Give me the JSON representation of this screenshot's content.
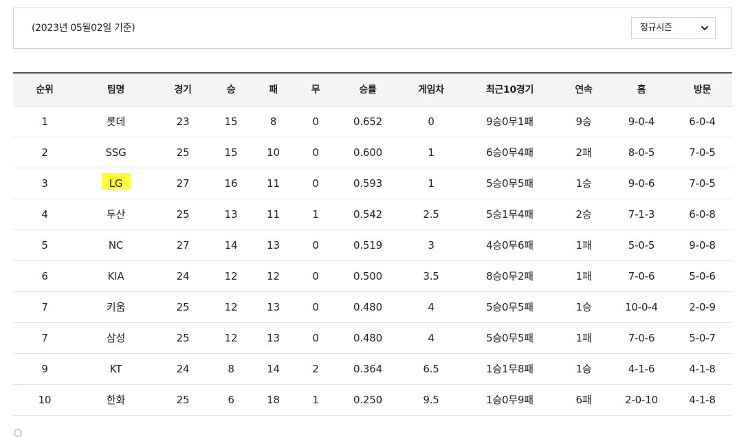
{
  "filter": {
    "date_label": "(2023년 05월02일 기준)",
    "season_selected": "정규시즌"
  },
  "table": {
    "headers": [
      "순위",
      "팀명",
      "경기",
      "승",
      "패",
      "무",
      "승률",
      "게임차",
      "최근10경기",
      "연속",
      "홈",
      "방문"
    ],
    "rows": [
      [
        "1",
        "롯데",
        "23",
        "15",
        "8",
        "0",
        "0.652",
        "0",
        "9승0무1패",
        "9승",
        "9-0-4",
        "6-0-4"
      ],
      [
        "2",
        "SSG",
        "25",
        "15",
        "10",
        "0",
        "0.600",
        "1",
        "6승0무4패",
        "2패",
        "8-0-5",
        "7-0-5"
      ],
      [
        "3",
        "LG",
        "27",
        "16",
        "11",
        "0",
        "0.593",
        "1",
        "5승0무5패",
        "1승",
        "9-0-6",
        "7-0-5"
      ],
      [
        "4",
        "두산",
        "25",
        "13",
        "11",
        "1",
        "0.542",
        "2.5",
        "5승1무4패",
        "2승",
        "7-1-3",
        "6-0-8"
      ],
      [
        "5",
        "NC",
        "27",
        "14",
        "13",
        "0",
        "0.519",
        "3",
        "4승0무6패",
        "1패",
        "5-0-5",
        "9-0-8"
      ],
      [
        "6",
        "KIA",
        "24",
        "12",
        "12",
        "0",
        "0.500",
        "3.5",
        "8승0무2패",
        "1패",
        "7-0-6",
        "5-0-6"
      ],
      [
        "7",
        "키움",
        "25",
        "12",
        "13",
        "0",
        "0.480",
        "4",
        "5승0무5패",
        "1승",
        "10-0-4",
        "2-0-9"
      ],
      [
        "7",
        "삼성",
        "25",
        "12",
        "13",
        "0",
        "0.480",
        "4",
        "5승0무5패",
        "1패",
        "7-0-6",
        "5-0-7"
      ],
      [
        "9",
        "KT",
        "24",
        "8",
        "14",
        "2",
        "0.364",
        "6.5",
        "1승1무8패",
        "1승",
        "4-1-6",
        "4-1-8"
      ],
      [
        "10",
        "한화",
        "25",
        "6",
        "18",
        "1",
        "0.250",
        "9.5",
        "1승0무9패",
        "6패",
        "2-0-10",
        "4-1-8"
      ]
    ],
    "highlighted_row": 2,
    "highlight_color": "#ffff33"
  },
  "icons": {
    "select_chevron": "chevron-down-icon"
  }
}
